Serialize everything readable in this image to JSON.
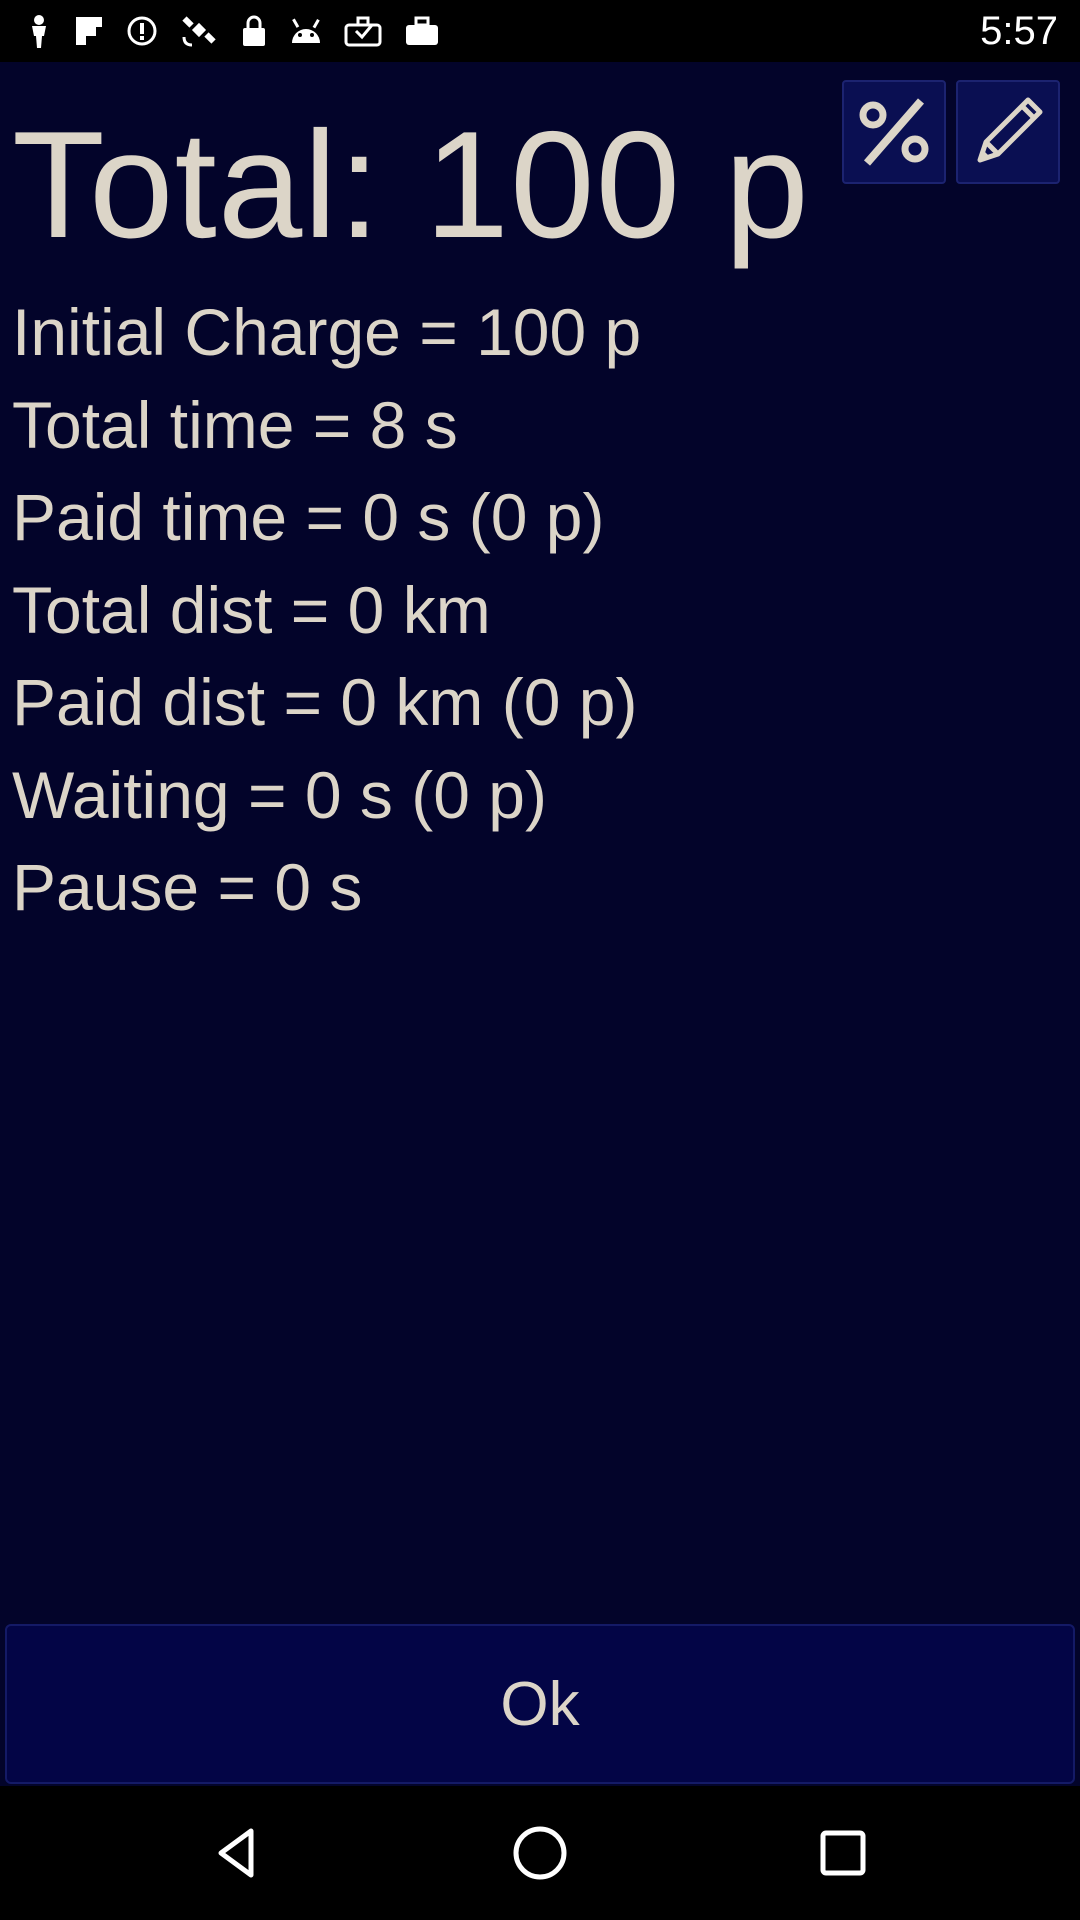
{
  "status_bar": {
    "time": "5:57",
    "icons": [
      "person-icon",
      "flipboard-icon",
      "alert-icon",
      "satellite-icon",
      "lock-icon",
      "android-icon",
      "download-bag-icon",
      "bag-icon"
    ]
  },
  "header": {
    "total": "Total: 100 p",
    "percent_button": "%",
    "edit_button_icon": "pencil-icon"
  },
  "details": [
    "Initial Charge = 100 p",
    "Total time = 8 s",
    "Paid time = 0 s (0 p)",
    "Total dist = 0 km",
    "Paid dist = 0 km (0 p)",
    "Waiting = 0 s (0 p)",
    "Pause = 0 s"
  ],
  "footer": {
    "ok_label": "Ok"
  },
  "nav": {
    "back_icon": "back-icon",
    "home_icon": "home-icon",
    "recent_icon": "recent-apps-icon"
  },
  "colors": {
    "background": "#03042a",
    "text": "#dcd5c8",
    "button": "#0a0f52"
  }
}
